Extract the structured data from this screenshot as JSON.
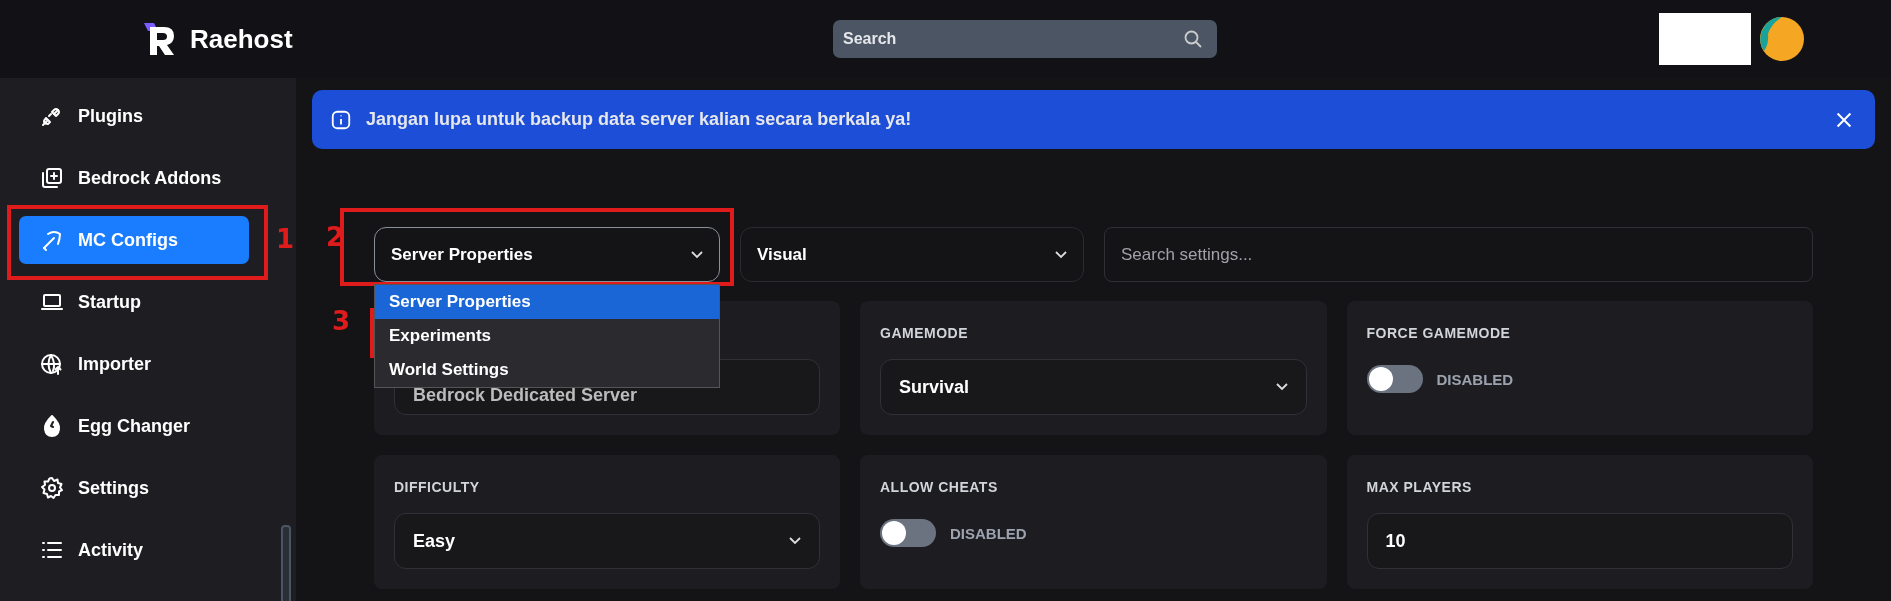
{
  "brand": {
    "name": "Raehost"
  },
  "search": {
    "placeholder": "Search"
  },
  "sidebar": {
    "items": [
      {
        "label": "Plugins",
        "selected": false
      },
      {
        "label": "Bedrock Addons",
        "selected": false
      },
      {
        "label": "MC Configs",
        "selected": true
      },
      {
        "label": "Startup",
        "selected": false
      },
      {
        "label": "Importer",
        "selected": false
      },
      {
        "label": "Egg Changer",
        "selected": false
      },
      {
        "label": "Settings",
        "selected": false
      },
      {
        "label": "Activity",
        "selected": false
      }
    ]
  },
  "notice": {
    "text": "Jangan lupa untuk backup data server kalian secara berkala ya!"
  },
  "filters": {
    "category": {
      "value": "Server Properties",
      "expanded": true,
      "options": [
        {
          "label": "Server Properties",
          "selected": true
        },
        {
          "label": "Experiments",
          "selected": false
        },
        {
          "label": "World Settings",
          "selected": false
        }
      ]
    },
    "view": {
      "value": "Visual"
    },
    "search": {
      "placeholder": "Search settings..."
    }
  },
  "settings": [
    {
      "kind": "text",
      "value": "Bedrock Dedicated Server"
    },
    {
      "kind": "select",
      "label": "GAMEMODE",
      "value": "Survival"
    },
    {
      "kind": "toggle",
      "label": "FORCE GAMEMODE",
      "on": false,
      "state_text": "DISABLED"
    },
    {
      "kind": "select",
      "label": "DIFFICULTY",
      "value": "Easy"
    },
    {
      "kind": "toggle",
      "label": "ALLOW CHEATS",
      "on": false,
      "state_text": "DISABLED"
    },
    {
      "kind": "input",
      "label": "MAX PLAYERS",
      "value": "10"
    }
  ],
  "annotations": [
    {
      "label": "1"
    },
    {
      "label": "2"
    },
    {
      "label": "3"
    }
  ]
}
